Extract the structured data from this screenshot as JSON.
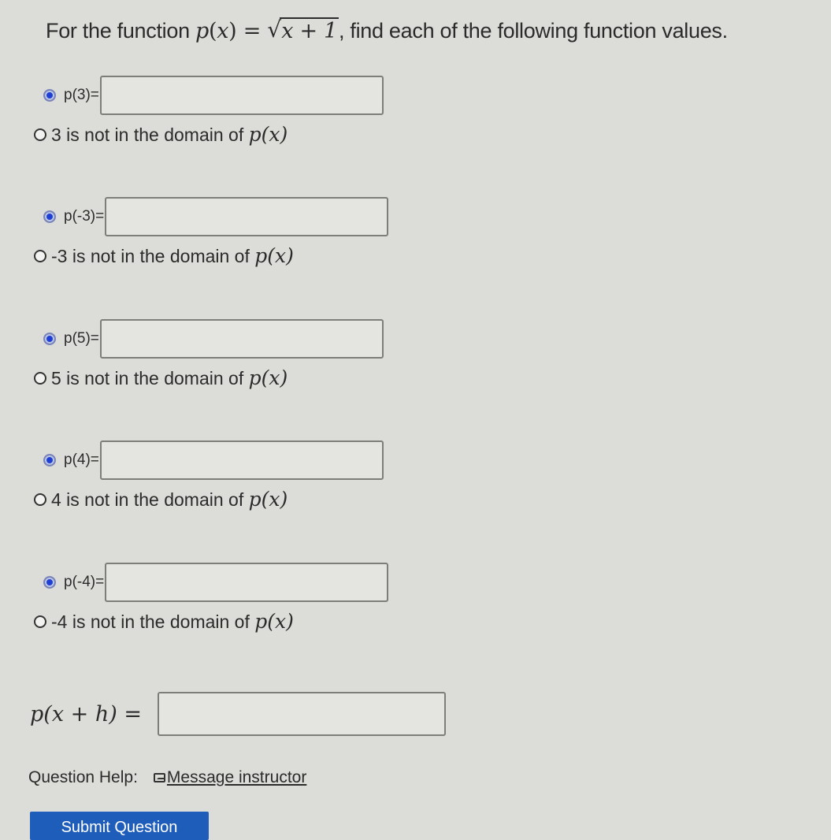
{
  "prompt": {
    "prefix": "For the function ",
    "fname": "p",
    "var": "x",
    "eq": " = ",
    "radicand": "x + 1",
    "suffix": ", find each of the following function values."
  },
  "items": [
    {
      "label": "p(3)=",
      "value": "",
      "option_num": "3",
      "option_text": " is not in the domain of ",
      "selected": "value"
    },
    {
      "label": "p(-3)=",
      "value": "",
      "option_num": "-3",
      "option_text": " is not in the domain of ",
      "selected": "value"
    },
    {
      "label": "p(5)=",
      "value": "",
      "option_num": "5",
      "option_text": " is not in the domain of ",
      "selected": "value"
    },
    {
      "label": "p(4)=",
      "value": "",
      "option_num": "4",
      "option_text": " is not in the domain of ",
      "selected": "value"
    },
    {
      "label": "p(-4)=",
      "value": "",
      "option_num": "-4",
      "option_text": " is not in the domain of ",
      "selected": "value"
    }
  ],
  "domain_fn": "p(x)",
  "pxh": {
    "label": "p(x + h) =",
    "value": ""
  },
  "help": {
    "label": "Question Help:",
    "link": "Message instructor",
    "icon": "mail-icon"
  },
  "submit": {
    "label": "Submit Question"
  }
}
